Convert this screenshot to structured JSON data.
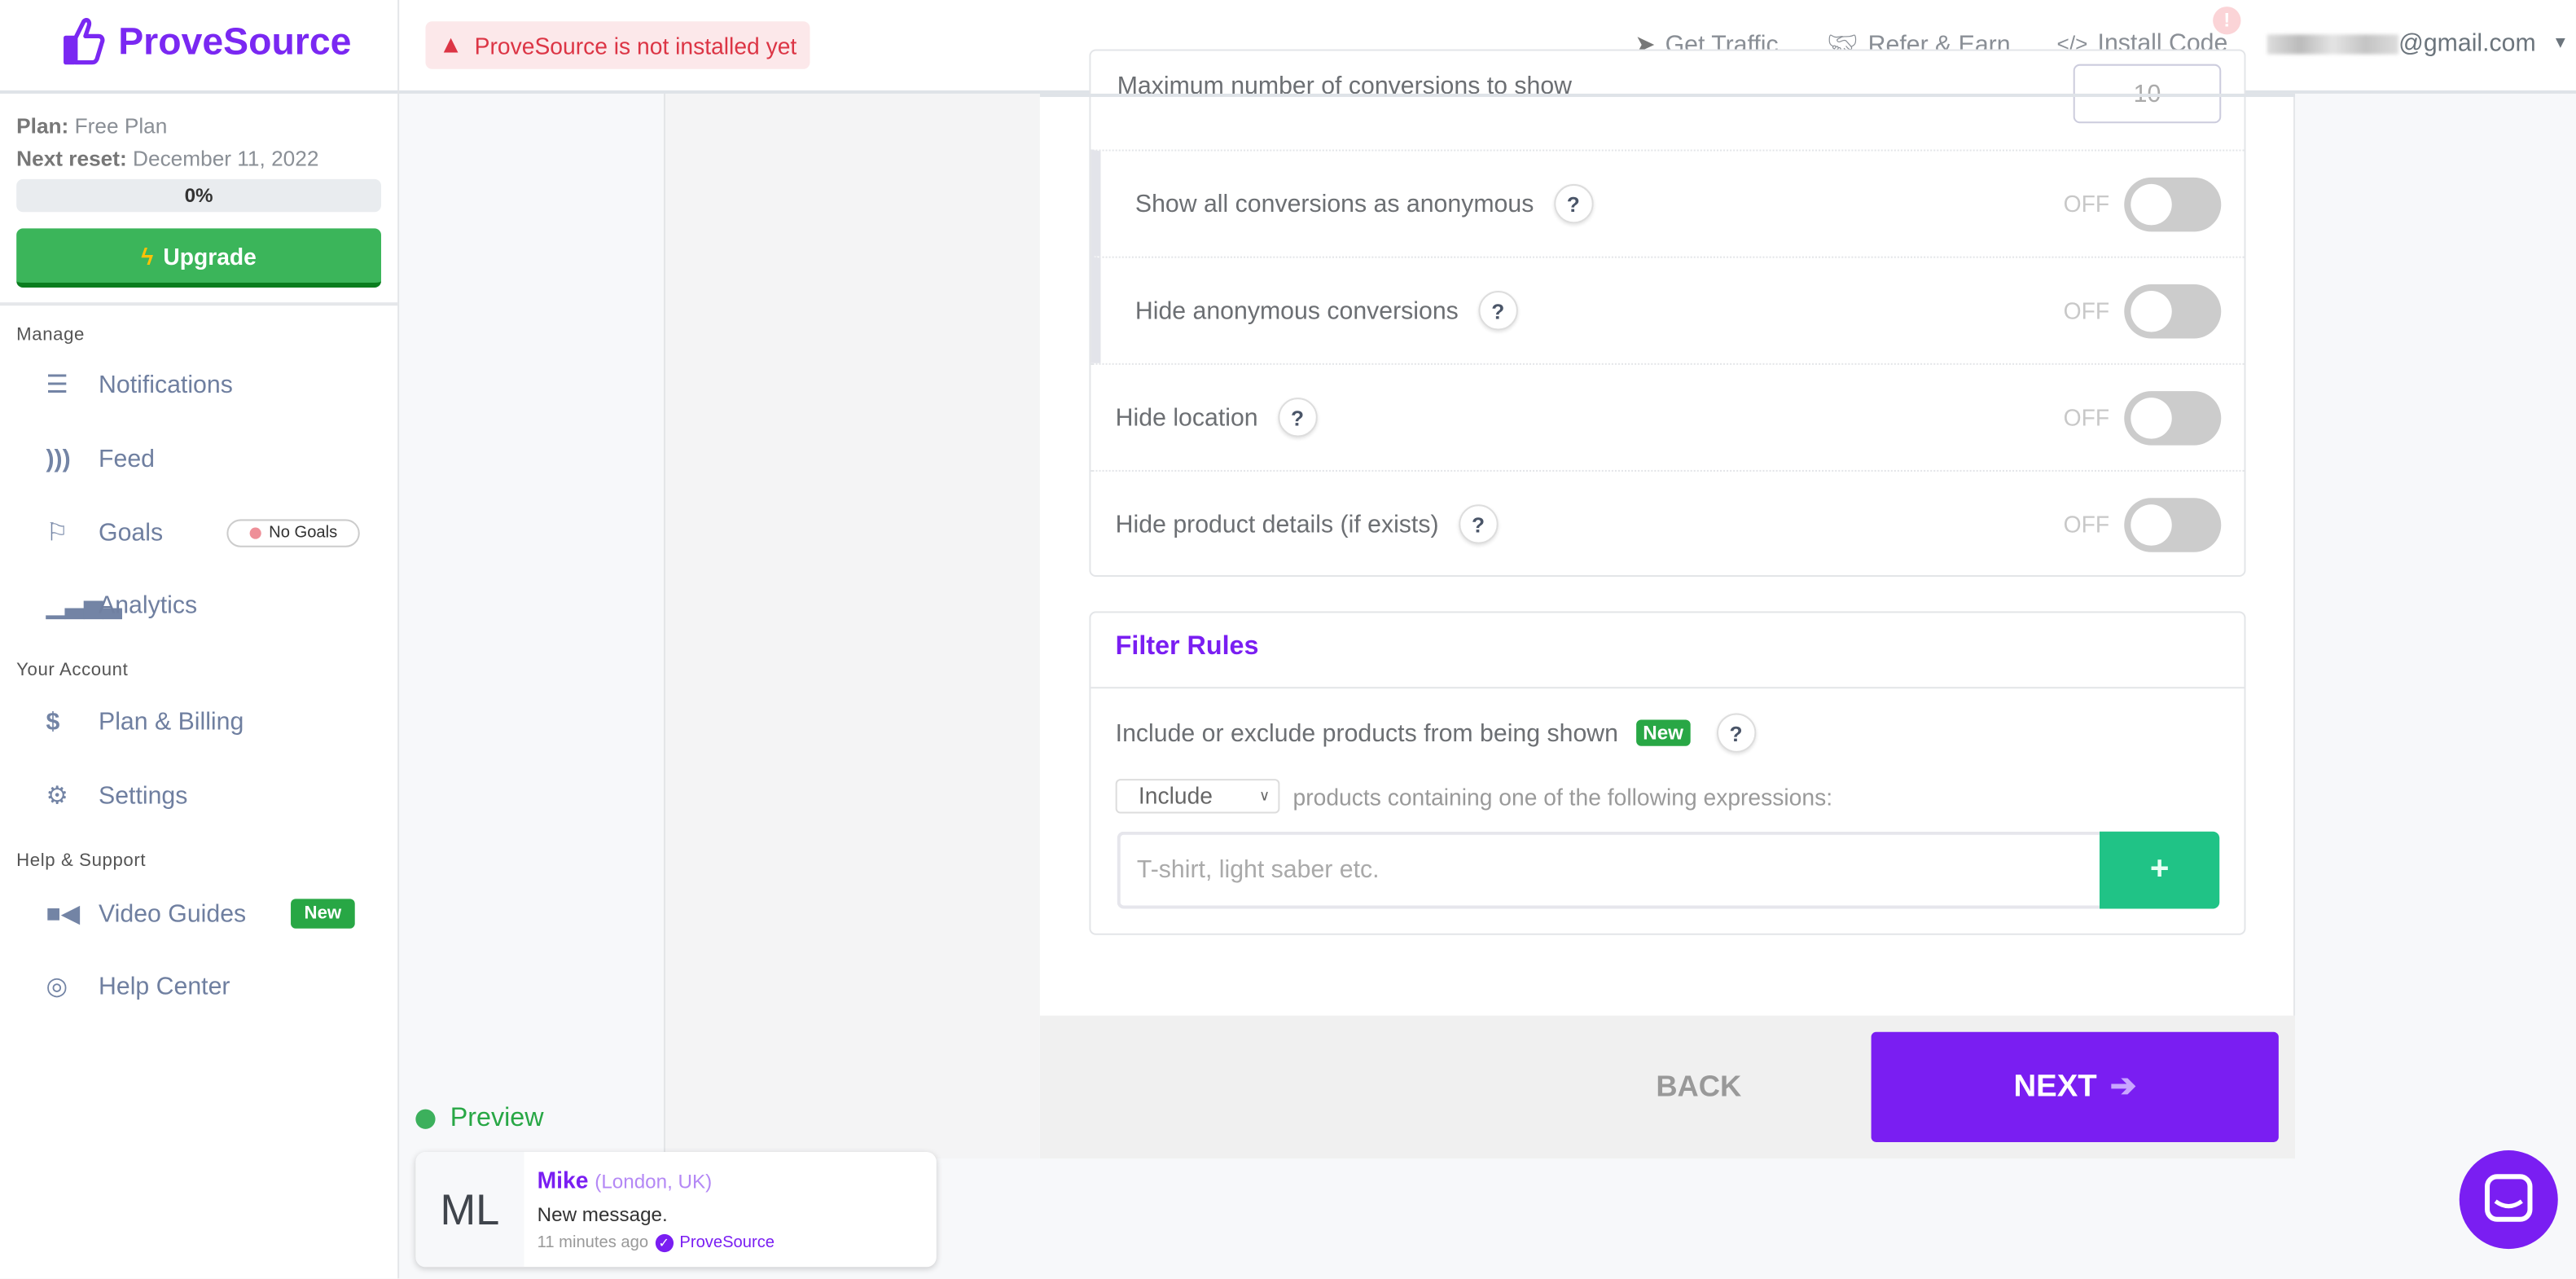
{
  "brand": {
    "name": "ProveSource",
    "color": "#7a28f2"
  },
  "header": {
    "alert": "ProveSource is not installed yet",
    "nav": [
      {
        "label": "Get Traffic",
        "icon": "cursor-icon"
      },
      {
        "label": "Refer & Earn",
        "icon": "handshake-icon"
      },
      {
        "label": "Install Code",
        "icon": "code-icon"
      }
    ],
    "install_badge": "!",
    "email_suffix": "@gmail.com"
  },
  "sidebar": {
    "plan_label": "Plan:",
    "plan_value": "Free Plan",
    "reset_label": "Next reset:",
    "reset_value": "December 11, 2022",
    "usage_percent": 0,
    "usage_text": "0%",
    "upgrade": "Upgrade",
    "sections": [
      {
        "title": "Manage",
        "items": [
          {
            "label": "Notifications",
            "icon": "list-icon"
          },
          {
            "label": "Feed",
            "icon": "rss-icon"
          },
          {
            "label": "Goals",
            "icon": "flag-icon",
            "badge": "No Goals"
          },
          {
            "label": "Analytics",
            "icon": "bar-chart-icon"
          }
        ]
      },
      {
        "title": "Your Account",
        "items": [
          {
            "label": "Plan & Billing",
            "icon": "dollar-icon"
          },
          {
            "label": "Settings",
            "icon": "gear-icon"
          }
        ]
      },
      {
        "title": "Help & Support",
        "items": [
          {
            "label": "Video Guides",
            "icon": "video-icon",
            "badge": "New"
          },
          {
            "label": "Help Center",
            "icon": "life-ring-icon"
          }
        ]
      }
    ]
  },
  "settings": {
    "max_conversions_label": "Maximum number of conversions to show",
    "max_conversions_value": "10",
    "toggles": [
      {
        "label": "Show all conversions as anonymous",
        "state": "OFF"
      },
      {
        "label": "Hide anonymous conversions",
        "state": "OFF"
      },
      {
        "label": "Hide location",
        "state": "OFF"
      },
      {
        "label": "Hide product details (if exists)",
        "state": "OFF"
      }
    ]
  },
  "filter": {
    "title": "Filter Rules",
    "description": "Include or exclude products from being shown",
    "new_badge": "New",
    "select_value": "Include",
    "select_suffix": "products containing one of the following expressions:",
    "input_placeholder": "T-shirt, light saber etc.",
    "add_button": "+"
  },
  "footer": {
    "back": "BACK",
    "next": "NEXT"
  },
  "preview": {
    "label": "Preview",
    "initials": "ML",
    "name": "Mike",
    "location": "(London, UK)",
    "message": "New message.",
    "time": "11 minutes ago",
    "source": "ProveSource"
  }
}
